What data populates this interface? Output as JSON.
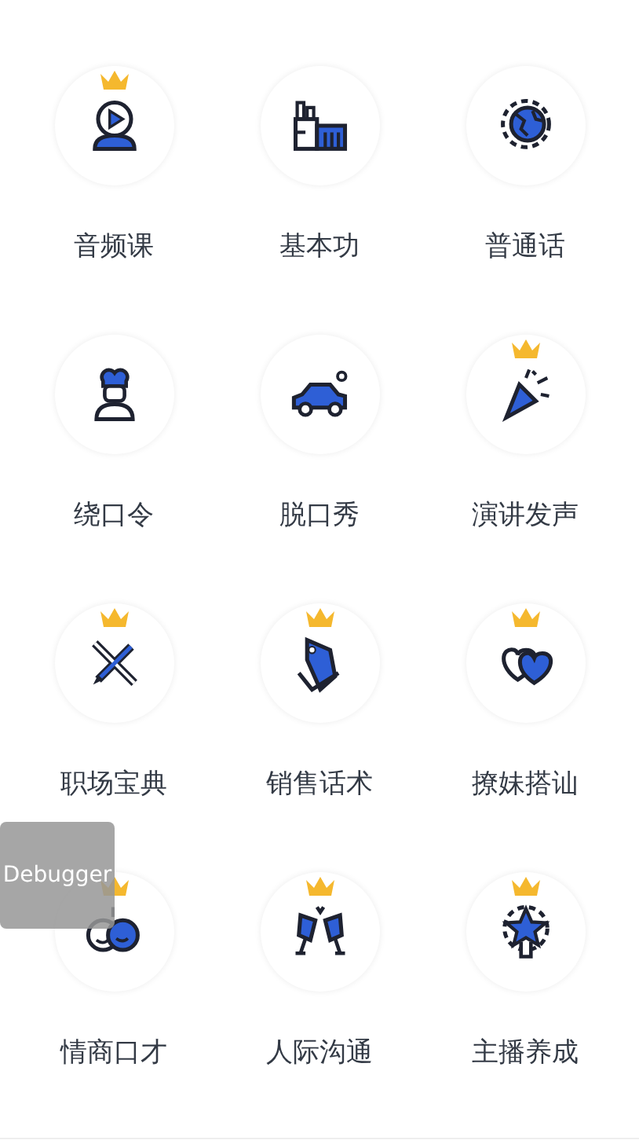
{
  "courses": [
    {
      "label": "音频课",
      "premium": true
    },
    {
      "label": "基本功",
      "premium": false
    },
    {
      "label": "普通话",
      "premium": false
    },
    {
      "label": "绕口令",
      "premium": false
    },
    {
      "label": "脱口秀",
      "premium": false
    },
    {
      "label": "演讲发声",
      "premium": true
    },
    {
      "label": "职场宝典",
      "premium": true
    },
    {
      "label": "销售话术",
      "premium": true
    },
    {
      "label": "撩妹搭讪",
      "premium": true
    },
    {
      "label": "情商口才",
      "premium": true
    },
    {
      "label": "人际沟通",
      "premium": true
    },
    {
      "label": "主播养成",
      "premium": true
    }
  ],
  "debugger_button": "Debugger"
}
